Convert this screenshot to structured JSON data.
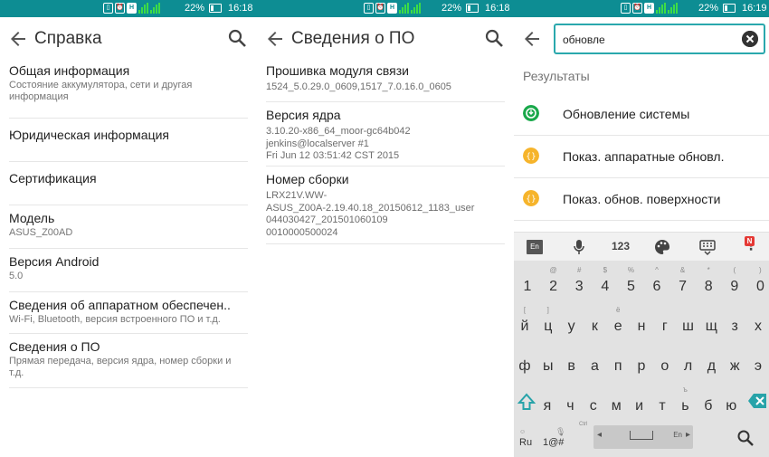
{
  "status_bar": {
    "battery_pct": "22%"
  },
  "phone1": {
    "time": "16:18",
    "title": "Справка",
    "items": [
      {
        "title": "Общая информация",
        "sub": "Состояние аккумулятора, сети и другая информация"
      },
      {
        "title": "Юридическая информация",
        "sub": ""
      },
      {
        "title": "Сертификация",
        "sub": ""
      },
      {
        "title": "Модель",
        "sub": "ASUS_Z00AD"
      },
      {
        "title": "Версия Android",
        "sub": "5.0"
      },
      {
        "title": "Сведения об аппаратном обеспечен..",
        "sub": "Wi-Fi, Bluetooth, версия встроенного ПО и т.д."
      },
      {
        "title": "Сведения о ПО",
        "sub": "Прямая передача, версия ядра, номер сборки и т.д."
      }
    ]
  },
  "phone2": {
    "time": "16:18",
    "title": "Сведения о ПО",
    "items": [
      {
        "title": "Прошивка модуля связи",
        "lines": [
          "1524_5.0.29.0_0609,1517_7.0.16.0_0605"
        ]
      },
      {
        "title": "Версия ядра",
        "lines": [
          "3.10.20-x86_64_moor-gc64b042",
          "jenkins@localserver #1",
          "Fri Jun 12 03:51:42 CST 2015"
        ]
      },
      {
        "title": "Номер сборки",
        "lines": [
          "LRX21V.WW-",
          "ASUS_Z00A-2.19.40.18_20150612_1183_user",
          "044030427_201501060109",
          "0010000500024"
        ]
      }
    ]
  },
  "phone3": {
    "time": "16:19",
    "search": {
      "query": "обновле"
    },
    "results_heading": "Результаты",
    "results": [
      {
        "label": "Обновление системы",
        "icon": "system-update-icon",
        "color": "#19a84a"
      },
      {
        "label": "Показ. аппаратные обновл.",
        "icon": "developer-options-icon",
        "color": "#f6b42b"
      },
      {
        "label": "Показ. обнов. поверхности",
        "icon": "developer-options-icon",
        "color": "#f6b42b"
      }
    ],
    "keyboard": {
      "toolbar": {
        "lang": "En",
        "numbers": "123",
        "badge": "N"
      },
      "row1": [
        {
          "k": "1",
          "h": ""
        },
        {
          "k": "2",
          "h": "@"
        },
        {
          "k": "3",
          "h": "#"
        },
        {
          "k": "4",
          "h": "$"
        },
        {
          "k": "5",
          "h": "%"
        },
        {
          "k": "6",
          "h": "^"
        },
        {
          "k": "7",
          "h": "&"
        },
        {
          "k": "8",
          "h": "*"
        },
        {
          "k": "9",
          "h": "("
        },
        {
          "k": "0",
          "h": ")"
        }
      ],
      "row2": [
        {
          "k": "й",
          "h": "["
        },
        {
          "k": "ц",
          "h": "]"
        },
        {
          "k": "у",
          "h": ""
        },
        {
          "k": "к",
          "h": ""
        },
        {
          "k": "е",
          "h": "ё"
        },
        {
          "k": "н",
          "h": ""
        },
        {
          "k": "г",
          "h": ""
        },
        {
          "k": "ш",
          "h": ""
        },
        {
          "k": "щ",
          "h": ""
        },
        {
          "k": "з",
          "h": ""
        },
        {
          "k": "х",
          "h": ""
        }
      ],
      "row3": [
        {
          "k": "ф",
          "h": ""
        },
        {
          "k": "ы",
          "h": ""
        },
        {
          "k": "в",
          "h": ""
        },
        {
          "k": "а",
          "h": ""
        },
        {
          "k": "п",
          "h": ""
        },
        {
          "k": "р",
          "h": ""
        },
        {
          "k": "о",
          "h": ""
        },
        {
          "k": "л",
          "h": ""
        },
        {
          "k": "д",
          "h": ""
        },
        {
          "k": "ж",
          "h": ""
        },
        {
          "k": "э",
          "h": ""
        }
      ],
      "row4": [
        {
          "k": "я",
          "h": ""
        },
        {
          "k": "ч",
          "h": ""
        },
        {
          "k": "с",
          "h": ""
        },
        {
          "k": "м",
          "h": ""
        },
        {
          "k": "и",
          "h": ""
        },
        {
          "k": "т",
          "h": ""
        },
        {
          "k": "ь",
          "h": "ъ"
        },
        {
          "k": "б",
          "h": ""
        },
        {
          "k": "ю",
          "h": ""
        }
      ],
      "bottom": {
        "ru": "Ru",
        "sym": "1@#",
        "space_lang": "En",
        "ctrl_hint": "Ctrl"
      }
    }
  }
}
